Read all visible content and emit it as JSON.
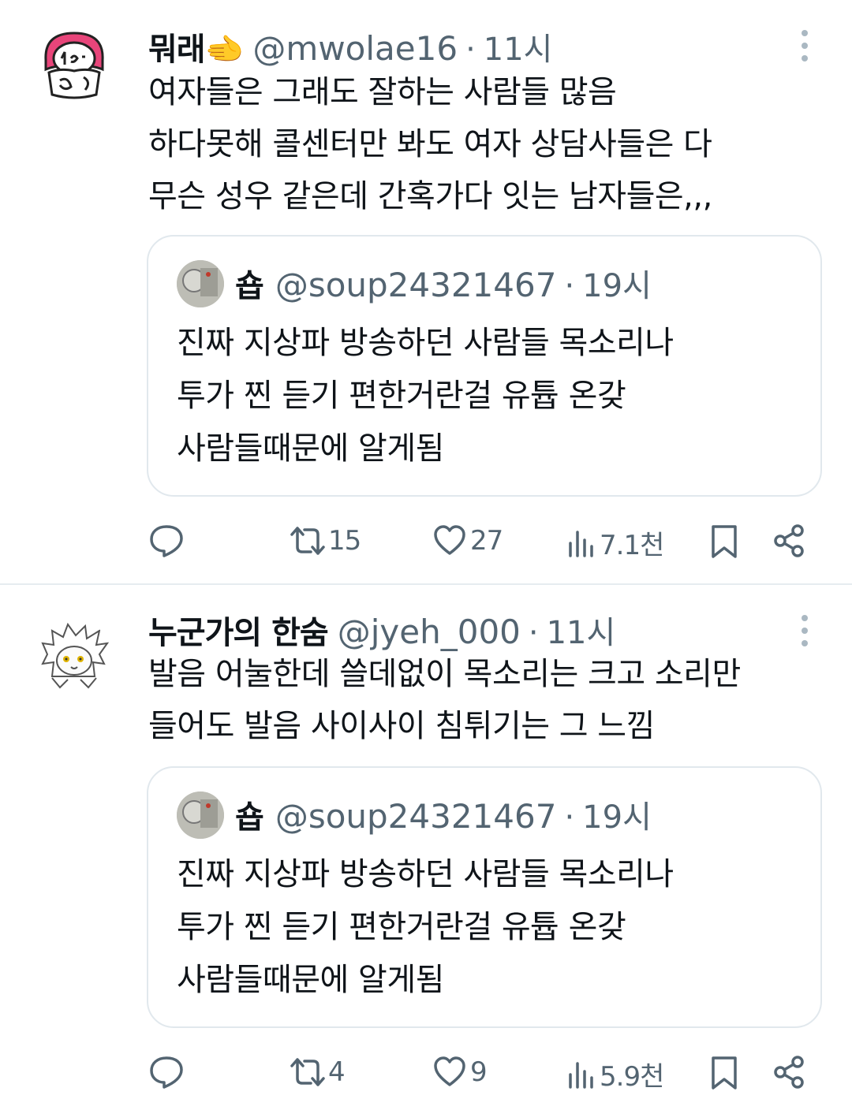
{
  "tweets": [
    {
      "name": "뭐래🫲",
      "handle": "@mwolae16",
      "sep": "·",
      "time": "11시",
      "lines": [
        "여자들은 그래도 잘하는 사람들 많음",
        "하다못해 콜센터만 봐도 여자 상담사들은 다",
        "무슨 성우 같은데 간혹가다 잇는 남자들은,,,"
      ],
      "quote": {
        "name": "숍",
        "handle": "@soup24321467",
        "sep": "·",
        "time": "19시",
        "lines": [
          "진짜 지상파 방송하던 사람들 목소리나",
          "투가 찐 듣기 편한거란걸 유튭 온갖",
          "사람들때문에 알게됨"
        ]
      },
      "retweets": "15",
      "likes": "27",
      "views": "7.1천"
    },
    {
      "name": "누군가의 한숨",
      "handle": "@jyeh_000",
      "sep": "·",
      "time": "11시",
      "lines": [
        "발음 어눌한데 쓸데없이 목소리는 크고 소리만",
        "들어도 발음 사이사이 침튀기는 그 느낌"
      ],
      "quote": {
        "name": "숍",
        "handle": "@soup24321467",
        "sep": "·",
        "time": "19시",
        "lines": [
          "진짜 지상파 방송하던 사람들 목소리나",
          "투가 찐 듣기 편한거란걸 유튭 온갖",
          "사람들때문에 알게됨"
        ]
      },
      "retweets": "4",
      "likes": "9",
      "views": "5.9천"
    }
  ],
  "colors": {
    "secondary_text": "#536471",
    "border": "#e1e8ed",
    "avatar_pink": "#e8457a"
  }
}
